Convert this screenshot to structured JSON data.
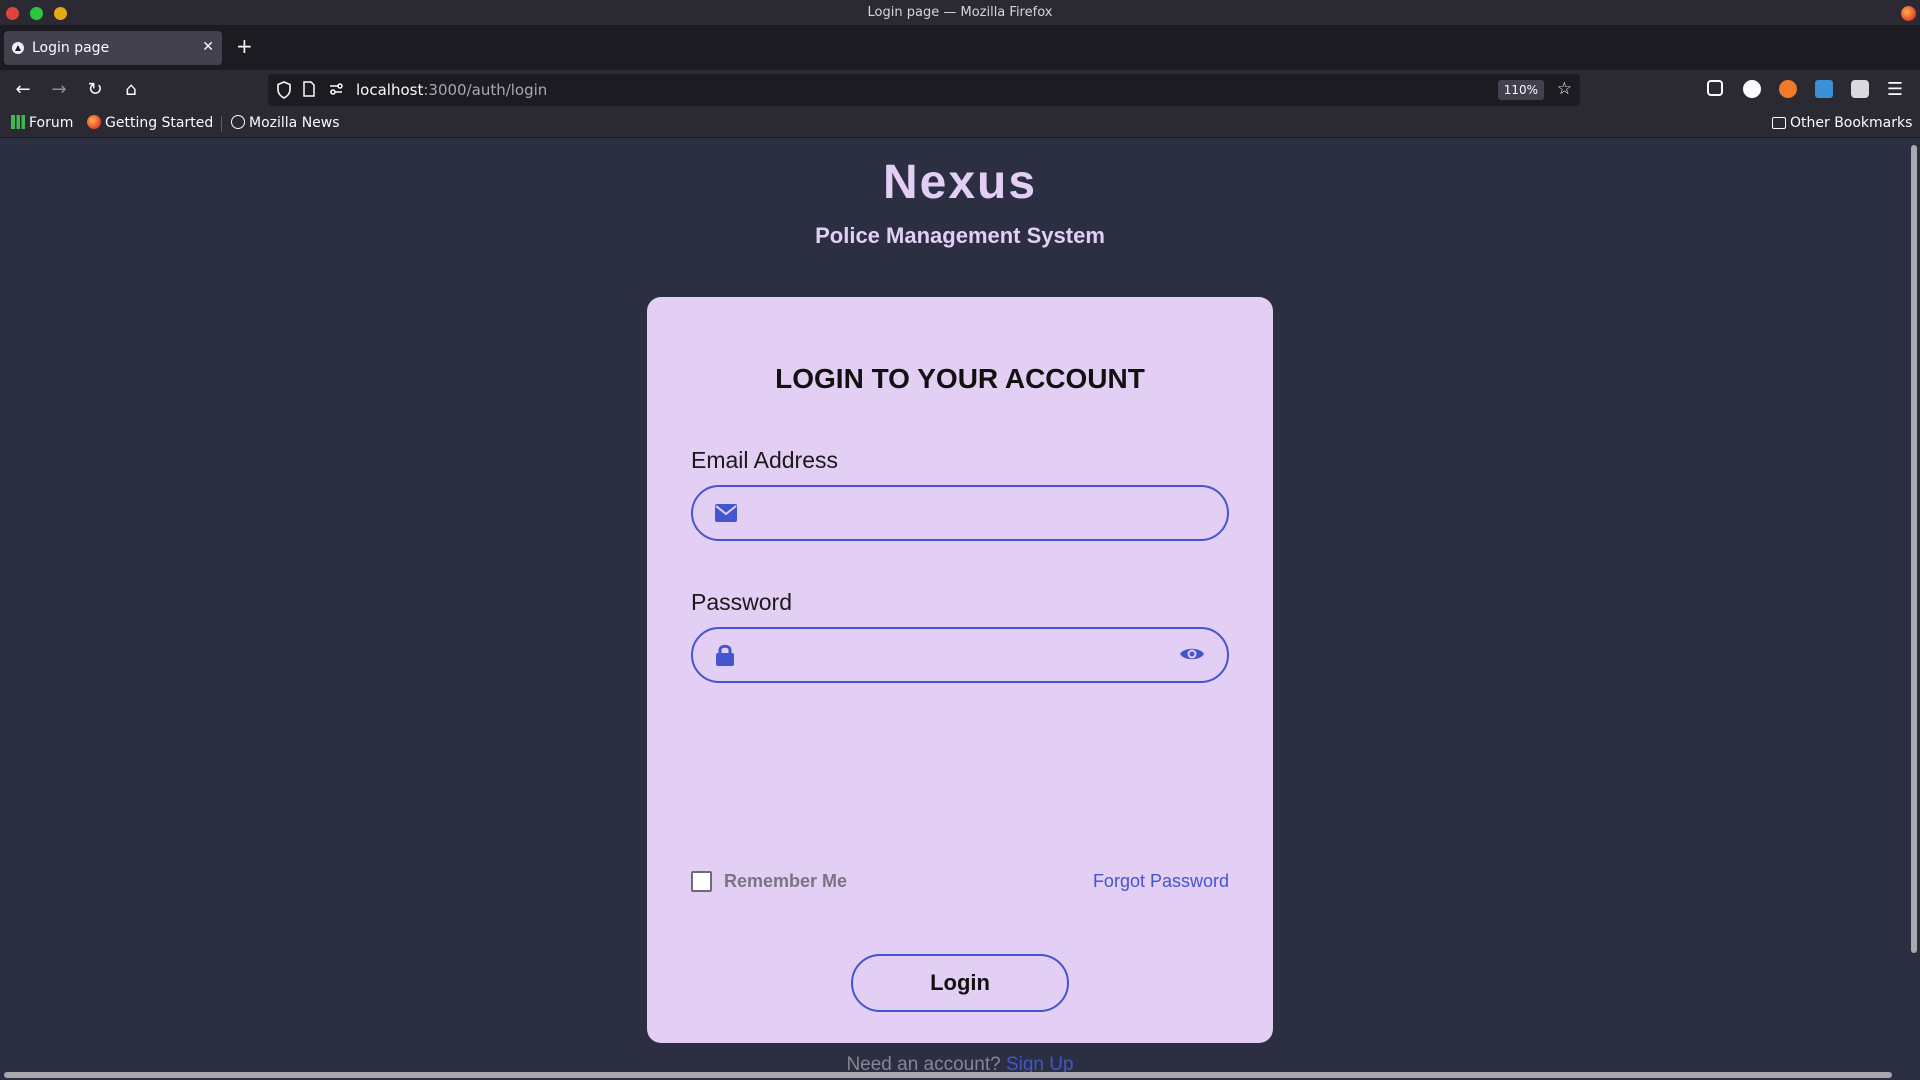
{
  "window": {
    "title": "Login page — Mozilla Firefox"
  },
  "tabs": [
    {
      "label": "Login page"
    }
  ],
  "navigation": {
    "url_host": "localhost",
    "url_path": ":3000/auth/login",
    "zoom": "110%"
  },
  "bookmarks": {
    "items": [
      "Forum",
      "Getting Started",
      "Mozilla News"
    ],
    "other": "Other Bookmarks"
  },
  "page": {
    "brand": "Nexus",
    "subtitle": "Police Management System",
    "card_title": "LOGIN TO YOUR ACCOUNT",
    "email_label": "Email Address",
    "email_value": "",
    "password_label": "Password",
    "password_value": "",
    "remember_label": "Remember Me",
    "remember_checked": false,
    "forgot_label": "Forgot Password",
    "login_label": "Login",
    "signup_prompt": "Need an account?",
    "signup_link": "Sign Up"
  },
  "colors": {
    "background": "#2b2f41",
    "card": "#e3cef4",
    "accent": "#4355cf",
    "brand_text": "#e3cff5"
  },
  "icons": [
    "mail-icon",
    "lock-icon",
    "eye-icon",
    "back-icon",
    "forward-icon",
    "reload-icon",
    "home-icon",
    "star-icon",
    "menu-icon"
  ]
}
